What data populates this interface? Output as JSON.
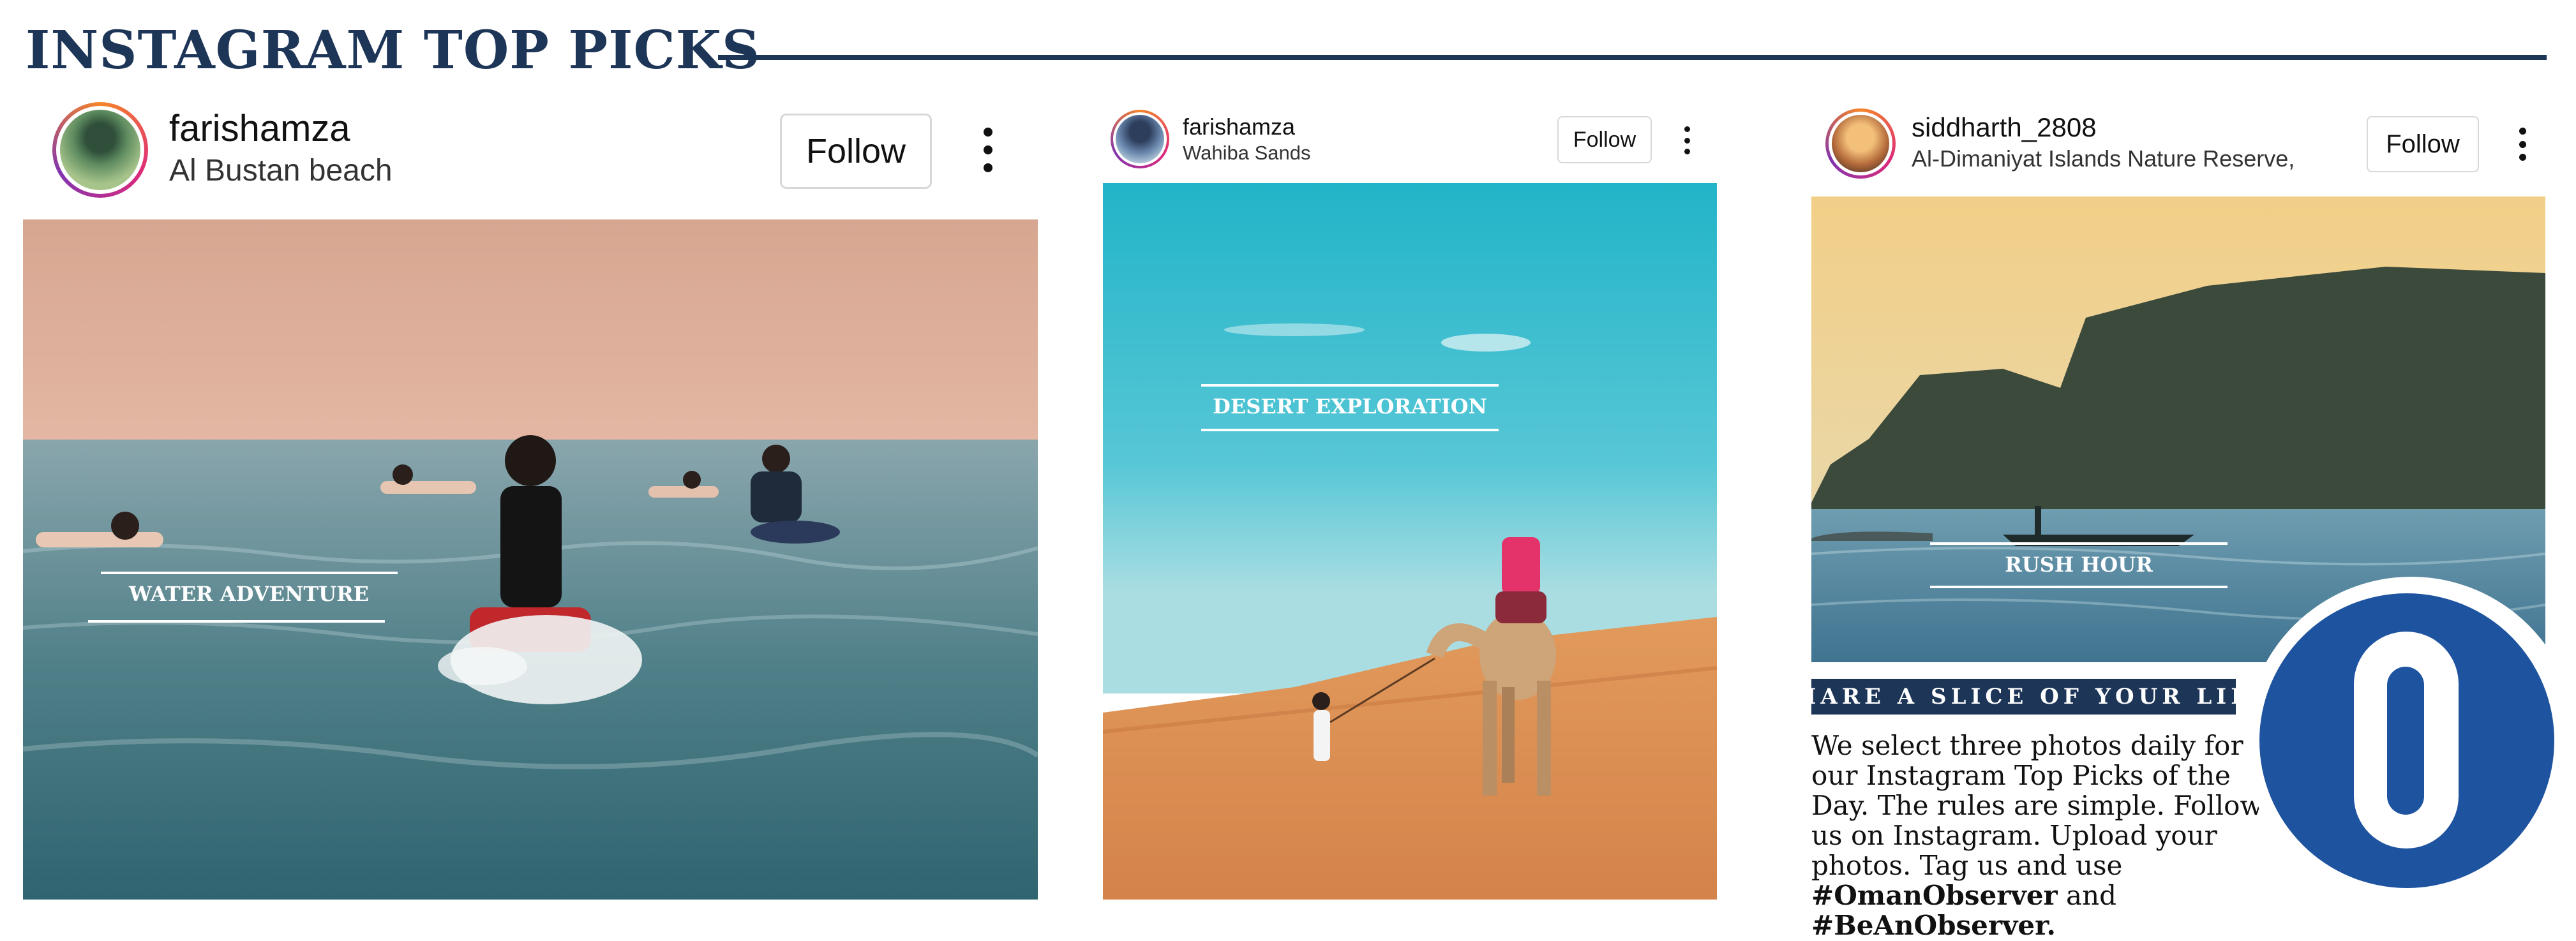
{
  "header": {
    "title": "INSTAGRAM TOP PICKS"
  },
  "posts": [
    {
      "username": "farishamza",
      "location": "Al Bustan beach",
      "follow_label": "Follow",
      "caption": "WATER ADVENTURE"
    },
    {
      "username": "farishamza",
      "location": "Wahiba Sands",
      "follow_label": "Follow",
      "caption": "DESERT EXPLORATION"
    },
    {
      "username": "siddharth_2808",
      "location": "Al-Dimaniyat Islands Nature Reserve,",
      "follow_label": "Follow",
      "caption": "RUSH HOUR"
    }
  ],
  "share": {
    "heading": "SHARE A SLICE OF YOUR LIFE",
    "body": "We select three photos daily for our Instagram Top Picks of the Day. The rules are simple. Follow us on Instagram. Upload your photos. Tag us and use",
    "tag1": "#OmanObserver",
    "and": "and",
    "tag2": "#BeAnObserver."
  },
  "icons": {
    "more_options": "vertical-ellipsis-icon",
    "logo": "oman-observer-o-logo"
  },
  "colors": {
    "navy": "#1d3557",
    "logo_blue": "#1e53a0"
  }
}
